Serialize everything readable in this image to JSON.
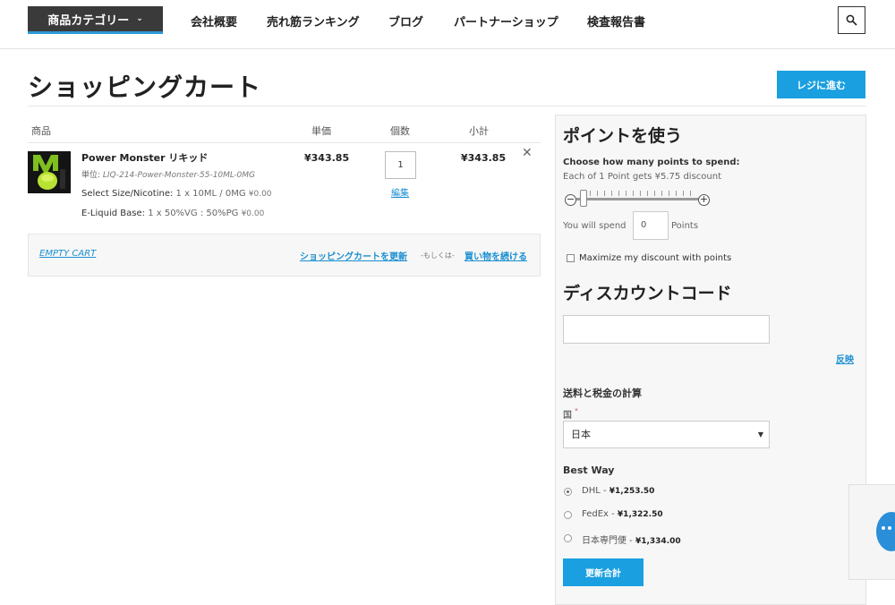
{
  "header": {
    "category_button": "商品カテゴリー",
    "nav": [
      "会社概要",
      "売れ筋ランキング",
      "ブログ",
      "パートナーショップ",
      "検査報告書"
    ]
  },
  "page": {
    "title": "ショッピングカート",
    "checkout_button": "レジに進む"
  },
  "cart": {
    "columns": [
      "商品",
      "単価",
      "個数",
      "小計"
    ],
    "item": {
      "name": "Power Monster リキッド",
      "sku_label": "単位:",
      "sku": "LIQ-214-Power-Monster-55-10ML-0MG",
      "option1_label": "Select Size/Nicotine:",
      "option1_value": "1 x 10ML / 0MG",
      "option1_price": "¥0.00",
      "option2_label": "E-Liquid Base:",
      "option2_value": "1 x 50%VG : 50%PG",
      "option2_price": "¥0.00",
      "price": "¥343.85",
      "qty": "1",
      "edit": "編集",
      "subtotal": "¥343.85",
      "remove": "✕"
    },
    "actions": {
      "empty": "EMPTY CART",
      "update": "ショッピングカートを更新",
      "or": "-もしくは-",
      "continue": "買い物を続ける"
    }
  },
  "sidebar": {
    "points": {
      "title": "ポイントを使う",
      "choose": "Choose how many points to spend:",
      "each": "Each of 1 Point gets ¥5.75 discount",
      "slider_level": 0,
      "spend_prefix": "You will spend",
      "spend_value": "0",
      "spend_suffix": "Points",
      "maximize": "Maximize my discount with points"
    },
    "discount": {
      "title": "ディスカウントコード",
      "apply": "反映"
    },
    "shipping": {
      "title": "送料と税金の計算",
      "country_label": "国",
      "required_mark": "*",
      "country_value": "日本",
      "method_title": "Best Way",
      "options": [
        {
          "name": "DHL",
          "price": "¥1,253.50",
          "selected": true
        },
        {
          "name": "FedEx",
          "price": "¥1,322.50",
          "selected": false
        },
        {
          "name": "日本専門便",
          "price": "¥1,334.00",
          "selected": false
        }
      ],
      "update_button": "更新合計"
    }
  },
  "icons": {
    "search": "search-icon",
    "chevron": "chevron-down-icon",
    "chat": "chat-icon"
  },
  "colors": {
    "accent": "#1a9fe0",
    "link": "#1a8fd0",
    "nav_dark": "#3a3a3a"
  }
}
